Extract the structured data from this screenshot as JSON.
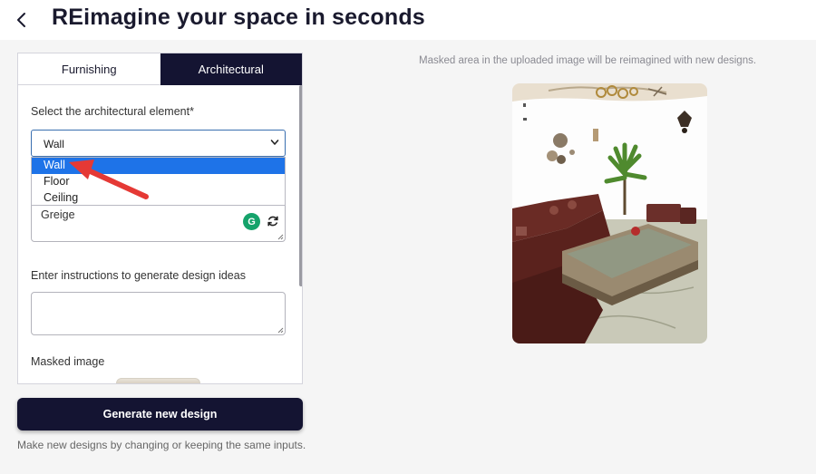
{
  "header": {
    "title": "REimagine your space in seconds",
    "back_icon": "chevron-left-icon"
  },
  "tabs": [
    {
      "label": "Furnishing",
      "active": false
    },
    {
      "label": "Architectural",
      "active": true
    }
  ],
  "form": {
    "element_label": "Select the architectural element*",
    "element_value": "Wall",
    "element_options": [
      "Wall",
      "Floor",
      "Ceiling"
    ],
    "color_value": "Greige",
    "grammarly_badge": "G",
    "instructions_label": "Enter instructions to generate design ideas",
    "instructions_value": "",
    "masked_image_label": "Masked image"
  },
  "actions": {
    "generate_label": "Generate new design",
    "hint": "Make new designs by changing or keeping the same inputs."
  },
  "preview": {
    "caption": "Masked area in the uploaded image will be reimagined with new designs."
  },
  "colors": {
    "accent_dark": "#141432",
    "dropdown_highlight": "#1e73e8",
    "arrow": "#e53935",
    "grammarly": "#15a36b"
  }
}
